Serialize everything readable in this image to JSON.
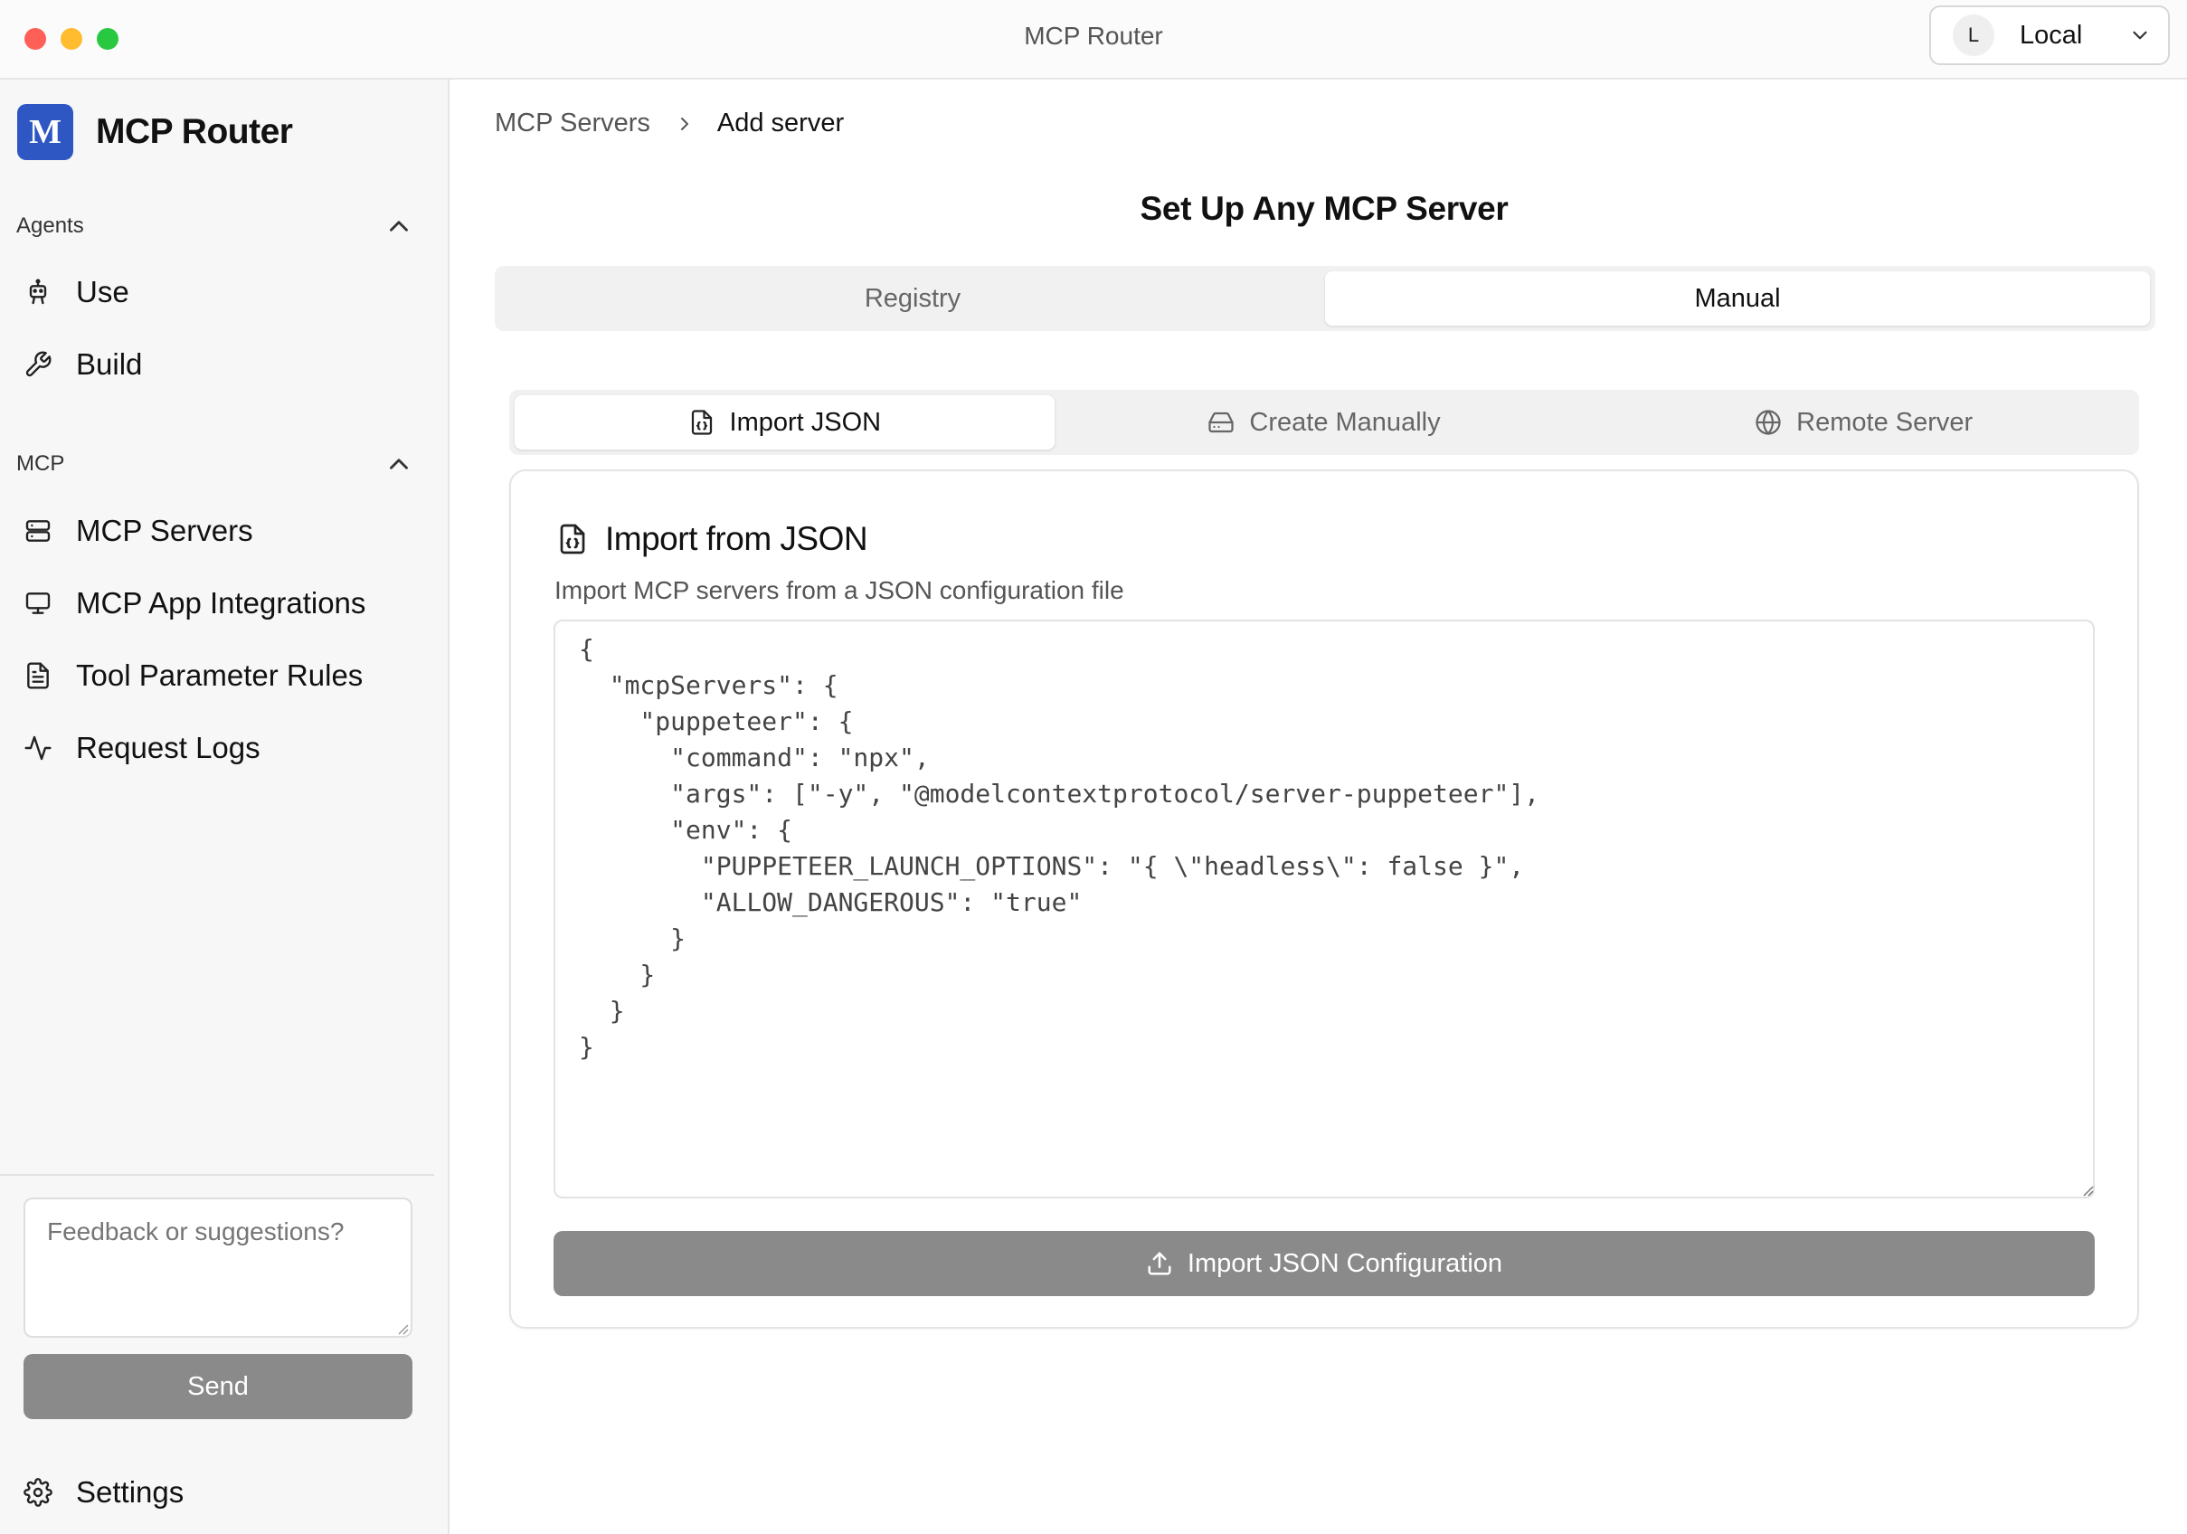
{
  "window": {
    "title": "MCP Router"
  },
  "profile": {
    "initial": "L",
    "name": "Local"
  },
  "sidebar": {
    "brand": {
      "logo_letter": "M",
      "name": "MCP Router",
      "logo_color": "#2f57c3"
    },
    "agents": {
      "label": "Agents",
      "items": [
        {
          "label": "Use",
          "icon": "robot-icon"
        },
        {
          "label": "Build",
          "icon": "wrench-icon"
        }
      ]
    },
    "mcp": {
      "label": "MCP",
      "items": [
        {
          "label": "MCP Servers",
          "icon": "server-icon"
        },
        {
          "label": "MCP App Integrations",
          "icon": "monitor-icon"
        },
        {
          "label": "Tool Parameter Rules",
          "icon": "file-text-icon"
        },
        {
          "label": "Request Logs",
          "icon": "activity-icon"
        }
      ]
    },
    "feedback": {
      "placeholder": "Feedback or suggestions?"
    },
    "send_label": "Send",
    "settings_label": "Settings"
  },
  "main": {
    "breadcrumb": [
      "MCP Servers",
      "Add server"
    ],
    "title": "Set Up Any MCP Server",
    "tabs": [
      {
        "label": "Registry",
        "active": false
      },
      {
        "label": "Manual",
        "active": true
      }
    ],
    "subtabs": [
      {
        "label": "Import JSON",
        "icon": "file-json-icon",
        "active": true
      },
      {
        "label": "Create Manually",
        "icon": "hard-drive-icon",
        "active": false
      },
      {
        "label": "Remote Server",
        "icon": "globe-icon",
        "active": false
      }
    ],
    "card": {
      "title": "Import from JSON",
      "description": "Import MCP servers from a JSON configuration file",
      "json": "{\n  \"mcpServers\": {\n    \"puppeteer\": {\n      \"command\": \"npx\",\n      \"args\": [\"-y\", \"@modelcontextprotocol/server-puppeteer\"],\n      \"env\": {\n        \"PUPPETEER_LAUNCH_OPTIONS\": \"{ \\\"headless\\\": false }\",\n        \"ALLOW_DANGEROUS\": \"true\"\n      }\n    }\n  }\n}",
      "button_label": "Import JSON Configuration"
    }
  },
  "colors": {
    "button_gray": "#8a8a8a",
    "sidebar_bg": "#f7f7f7",
    "tab_bg": "#f1f1f1"
  }
}
